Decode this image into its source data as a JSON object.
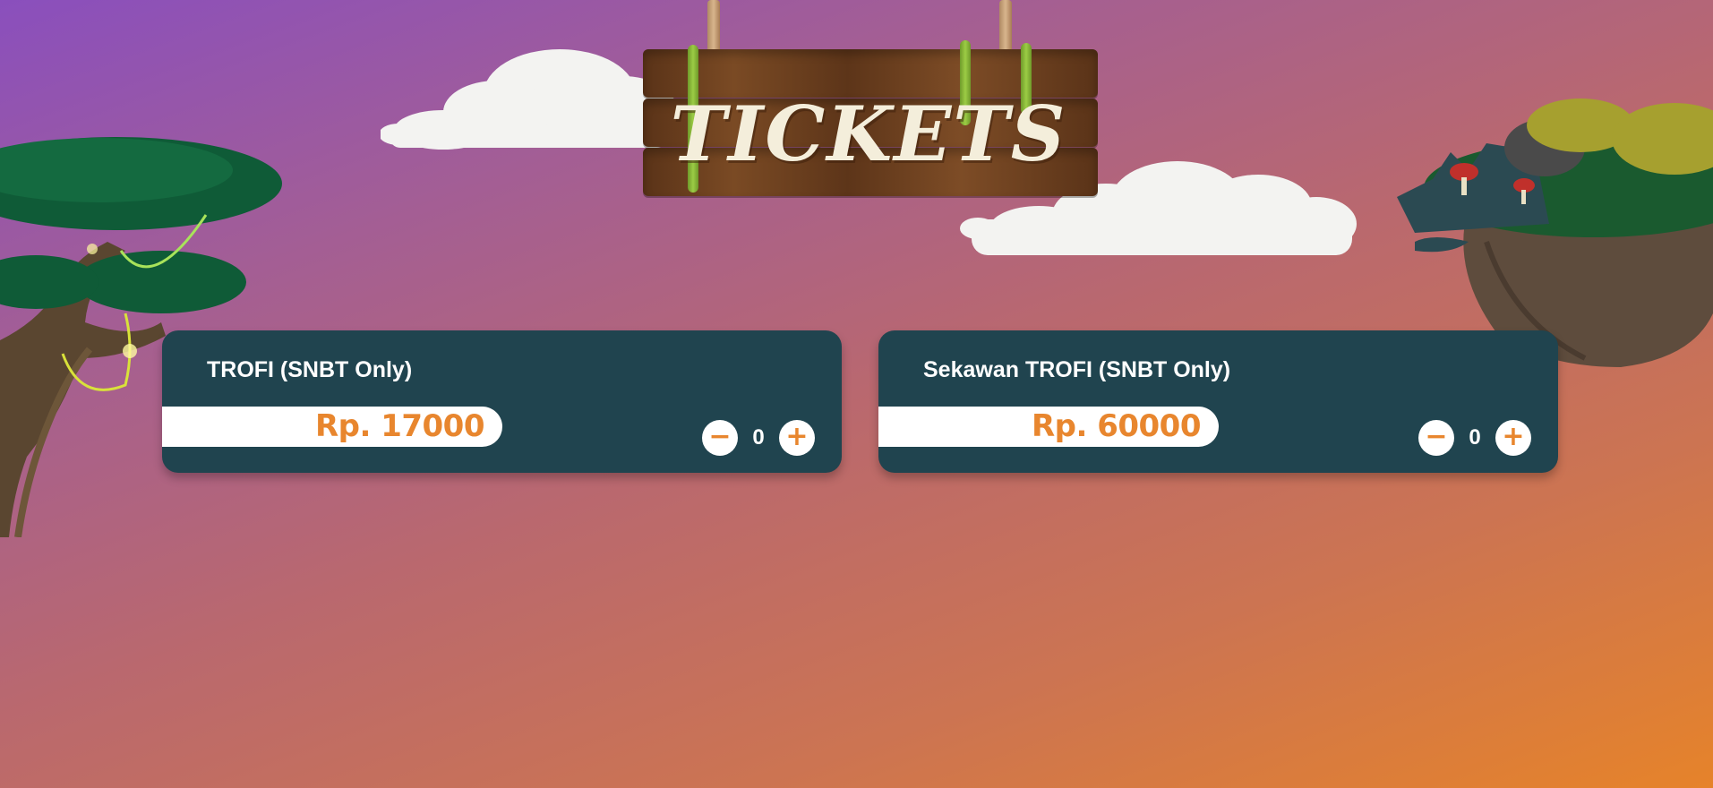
{
  "header": {
    "title": "TICKETS"
  },
  "tickets": [
    {
      "name": "TROFI (SNBT Only)",
      "price": "Rp. 17000",
      "quantity": "0",
      "decrement_label": "−",
      "increment_label": "+"
    },
    {
      "name": "Sekawan TROFI (SNBT Only)",
      "price": "Rp. 60000",
      "quantity": "0",
      "decrement_label": "−",
      "increment_label": "+"
    }
  ],
  "colors": {
    "card_bg": "#20444f",
    "accent": "#e8862e",
    "text": "#ffffff"
  },
  "decor": [
    "tree-illustration",
    "floating-island-illustration",
    "cloud-illustration",
    "wooden-sign-illustration"
  ]
}
